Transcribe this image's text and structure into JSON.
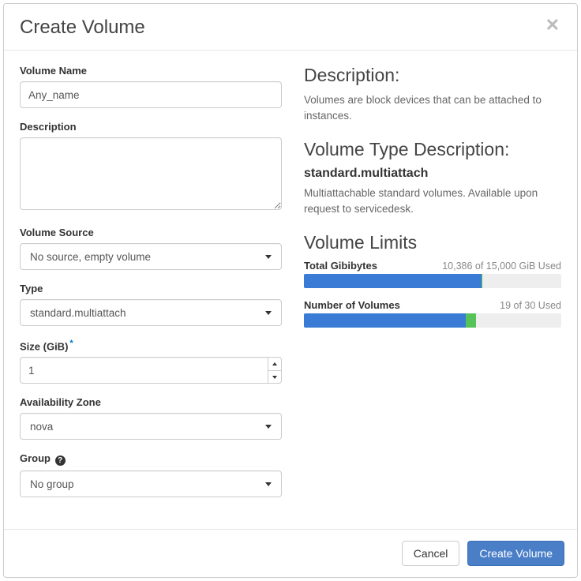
{
  "modal": {
    "title": "Create Volume",
    "close_glyph": "✕"
  },
  "form": {
    "volume_name": {
      "label": "Volume Name",
      "value": "Any_name"
    },
    "description": {
      "label": "Description",
      "value": ""
    },
    "volume_source": {
      "label": "Volume Source",
      "selected": "No source, empty volume"
    },
    "type": {
      "label": "Type",
      "selected": "standard.multiattach"
    },
    "size": {
      "label": "Size (GiB)",
      "value": "1",
      "required_marker": "*"
    },
    "az": {
      "label": "Availability Zone",
      "selected": "nova"
    },
    "group": {
      "label": "Group",
      "help_glyph": "?",
      "selected": "No group"
    }
  },
  "info": {
    "desc_heading": "Description:",
    "desc_text": "Volumes are block devices that can be attached to instances.",
    "type_desc_heading": "Volume Type Description:",
    "type_name": "standard.multiattach",
    "type_desc_text": "Multiattachable standard volumes. Available upon request to servicedesk.",
    "limits_heading": "Volume Limits",
    "gib": {
      "label": "Total Gibibytes",
      "used_text": "10,386 of 15,000 GiB Used",
      "blue_pct": 69,
      "green_pct": 0.2
    },
    "vols": {
      "label": "Number of Volumes",
      "used_text": "19 of 30 Used",
      "blue_pct": 63,
      "green_pct": 4
    }
  },
  "footer": {
    "cancel": "Cancel",
    "submit": "Create Volume"
  }
}
